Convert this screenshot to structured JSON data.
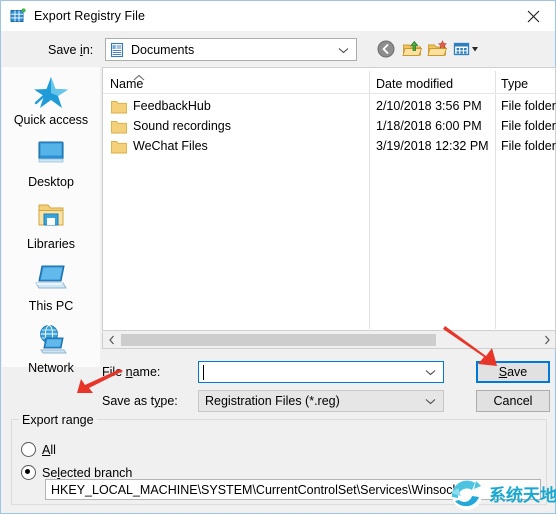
{
  "window": {
    "title": "Export Registry File",
    "icon": "registry-editor-icon",
    "close_label": "✕"
  },
  "toolbar": {
    "savein_label": "Save in:",
    "savein_value": "Documents",
    "savein_icon": "documents-folder-icon",
    "buttons": [
      {
        "name": "back-button",
        "icon": "back-arrow-icon"
      },
      {
        "name": "up-one-level-button",
        "icon": "up-folder-icon"
      },
      {
        "name": "new-folder-button",
        "icon": "new-folder-icon"
      },
      {
        "name": "views-button",
        "icon": "views-icon"
      }
    ]
  },
  "places": {
    "items": [
      {
        "label": "Quick access",
        "icon": "star-icon"
      },
      {
        "label": "Desktop",
        "icon": "monitor-icon"
      },
      {
        "label": "Libraries",
        "icon": "libraries-folder-icon"
      },
      {
        "label": "This PC",
        "icon": "computer-icon"
      },
      {
        "label": "Network",
        "icon": "network-globe-icon"
      }
    ]
  },
  "filelist": {
    "columns": [
      "Name",
      "Date modified",
      "Type"
    ],
    "sort_column": "Name",
    "sort_direction": "ascending",
    "rows": [
      {
        "name": "FeedbackHub",
        "date_modified": "2/10/2018 3:56 PM",
        "type": "File folder"
      },
      {
        "name": "Sound recordings",
        "date_modified": "1/18/2018 6:00 PM",
        "type": "File folder"
      },
      {
        "name": "WeChat Files",
        "date_modified": "3/19/2018 12:32 PM",
        "type": "File folder"
      }
    ]
  },
  "scrollbar": {
    "left_arrow": "‹",
    "right_arrow": "›"
  },
  "fields": {
    "filename_label_pre": "File ",
    "filename_label_key": "n",
    "filename_label_post": "ame:",
    "filename_value": "",
    "savetype_label_pre": "Save as t",
    "savetype_label_key": "y",
    "savetype_label_post": "pe:",
    "savetype_value": "Registration Files (*.reg)"
  },
  "buttons": {
    "save_pre": "",
    "save_key": "S",
    "save_post": "ave",
    "cancel_label": "Cancel"
  },
  "export_range": {
    "group_title": "Export range",
    "option_all_pre": "",
    "option_all_key": "A",
    "option_all_post": "ll",
    "option_all_selected": false,
    "option_branch_pre": "Se",
    "option_branch_key": "l",
    "option_branch_post": "ected branch",
    "option_branch_selected": true,
    "registry_path": "HKEY_LOCAL_MACHINE\\SYSTEM\\CurrentControlSet\\Services\\Winsock"
  },
  "annotations": {
    "arrow_save": "red-arrow-pointing-to-save-button",
    "arrow_filename": "red-arrow-pointing-to-file-name-label",
    "arrow_color": "#e8352a"
  },
  "watermark": {
    "text": "系统天地",
    "color": "#1aa7d0"
  }
}
